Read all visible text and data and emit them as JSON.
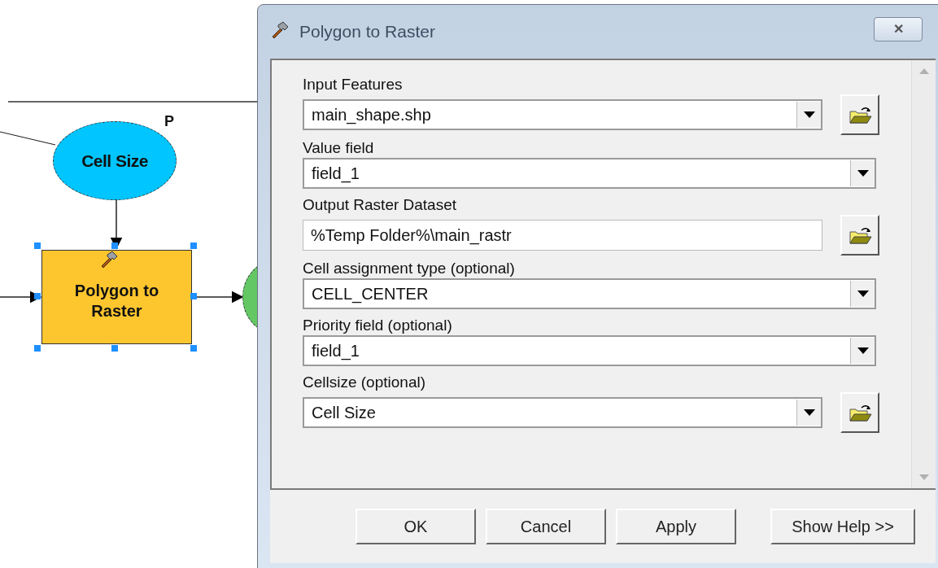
{
  "diagram": {
    "nodes": [
      {
        "kind": "variable",
        "label": "Cell Size",
        "badge": "P"
      },
      {
        "kind": "tool",
        "label": "Polygon to Raster",
        "selected": true
      },
      {
        "kind": "output"
      }
    ]
  },
  "dialog": {
    "title": "Polygon to Raster",
    "close": "✕",
    "parameters": [
      {
        "kind": "dropdown",
        "label": "Input Features",
        "value": "main_shape.shp",
        "browse": true
      },
      {
        "kind": "dropdown",
        "label": "Value field",
        "value": "field_1",
        "browse": false
      },
      {
        "kind": "text",
        "label": "Output Raster Dataset",
        "value": "%Temp Folder%\\main_rastr",
        "browse": true
      },
      {
        "kind": "dropdown",
        "label": "Cell assignment type (optional)",
        "value": "CELL_CENTER",
        "browse": false
      },
      {
        "kind": "dropdown",
        "label": "Priority field (optional)",
        "value": "field_1",
        "browse": false
      },
      {
        "kind": "dropdown",
        "label": "Cellsize (optional)",
        "value": "Cell Size",
        "browse": true
      }
    ],
    "buttons": [
      "OK",
      "Cancel",
      "Apply",
      "Show Help >>"
    ]
  }
}
